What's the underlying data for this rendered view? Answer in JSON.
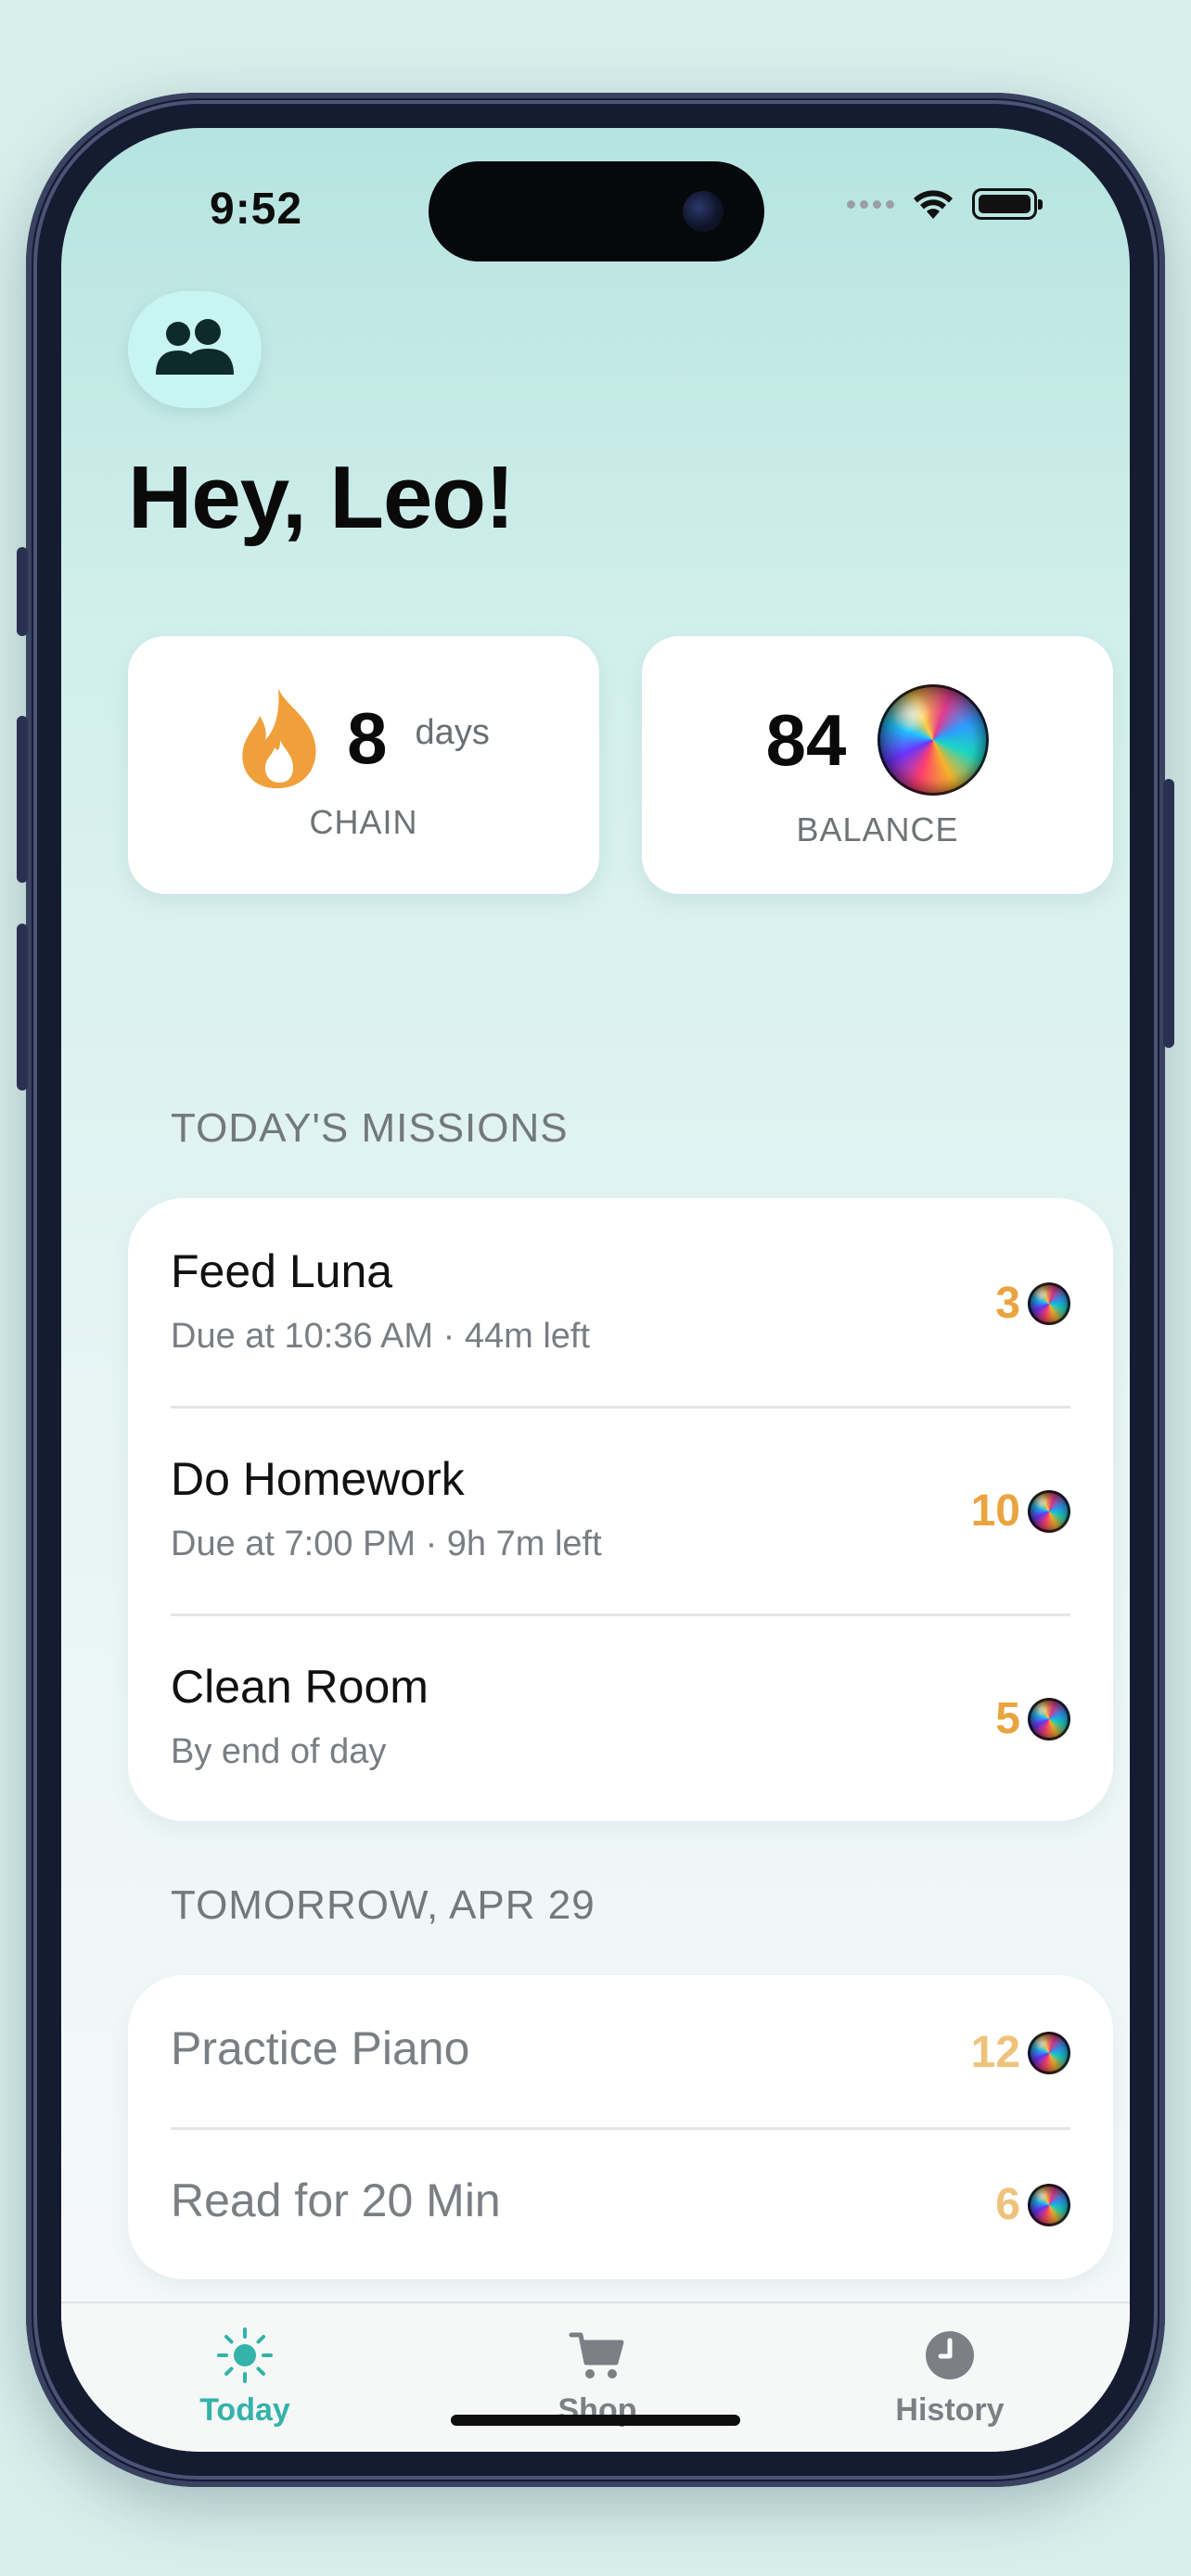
{
  "status_bar": {
    "time": "9:52"
  },
  "header": {
    "family_icon": "people-icon",
    "greeting": "Hey, Leo!"
  },
  "stats": {
    "chain": {
      "icon": "flame-icon",
      "value": "8",
      "unit": "days",
      "label": "CHAIN"
    },
    "balance": {
      "value": "84",
      "icon": "orb-coin-icon",
      "label": "BALANCE"
    }
  },
  "today": {
    "title": "TODAY'S MISSIONS",
    "missions": [
      {
        "title": "Feed Luna",
        "subtitle": "Due at 10:36 AM · 44m left",
        "reward": "3"
      },
      {
        "title": "Do Homework",
        "subtitle": "Due at 7:00 PM · 9h 7m left",
        "reward": "10"
      },
      {
        "title": "Clean Room",
        "subtitle": "By end of day",
        "reward": "5"
      }
    ]
  },
  "tomorrow": {
    "title": "TOMORROW, APR 29",
    "missions": [
      {
        "title": "Practice Piano",
        "reward": "12"
      },
      {
        "title": "Read for 20 Min",
        "reward": "6"
      }
    ]
  },
  "tabs": [
    {
      "label": "Today",
      "icon": "sun-icon",
      "active": true
    },
    {
      "label": "Shop",
      "icon": "cart-icon",
      "active": false
    },
    {
      "label": "History",
      "icon": "clock-icon",
      "active": false
    }
  ],
  "colors": {
    "accent": "#33b3aa",
    "reward": "#eaa43f",
    "flame": "#f0a03a"
  }
}
